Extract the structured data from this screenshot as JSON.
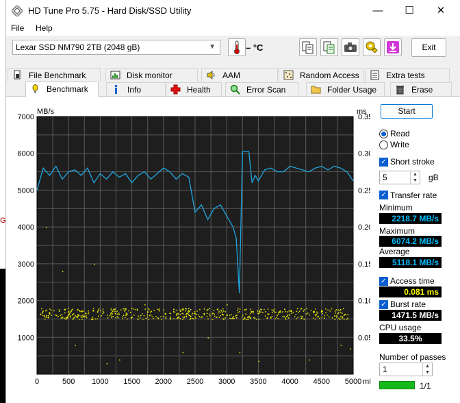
{
  "window": {
    "title": "HD Tune Pro 5.75 - Hard Disk/SSD Utility",
    "minimize": "—",
    "maximize": "☐",
    "close": "✕"
  },
  "menu": {
    "file": "File",
    "help": "Help"
  },
  "toolbar": {
    "drive": "Lexar SSD NM790 2TB (2048 gB)",
    "temperature": "– °C",
    "exit": "Exit"
  },
  "tabs_back": [
    "File Benchmark",
    "Disk monitor",
    "AAM",
    "Random Access",
    "Extra tests"
  ],
  "tabs_front": [
    "Benchmark",
    "Info",
    "Health",
    "Error Scan",
    "Folder Usage",
    "Erase"
  ],
  "side": {
    "start": "Start",
    "read": "Read",
    "write": "Write",
    "short_stroke": "Short stroke",
    "stroke_value": "5",
    "stroke_unit": "gB",
    "transfer_rate": "Transfer rate",
    "minimum_label": "Minimum",
    "minimum": "2218.7 MB/s",
    "maximum_label": "Maximum",
    "maximum": "6074.2 MB/s",
    "average_label": "Average",
    "average": "5118.1 MB/s",
    "access_time": "Access time",
    "access_value": "0.081 ms",
    "burst_rate": "Burst rate",
    "burst_value": "1471.5 MB/s",
    "cpu_label": "CPU usage",
    "cpu_value": "33.5%",
    "passes_label": "Number of passes",
    "passes_value": "1",
    "progress_text": "1/1",
    "progress_fraction": 1.0
  },
  "colors": {
    "transfer_line": "#1fa7e0",
    "access_dots": "#f0f000",
    "plot_bg": "#1e1e1e",
    "grid": "#5a5a5a"
  },
  "chart_data": {
    "type": "line",
    "left_unit": "MB/s",
    "right_unit": "ms",
    "x_unit": "mB",
    "x_ticks": [
      "0",
      "500",
      "1000",
      "1500",
      "2000",
      "2500",
      "3000",
      "3500",
      "4000",
      "4500",
      "5000"
    ],
    "y_left_ticks": [
      "7000",
      "6000",
      "5000",
      "4000",
      "3000",
      "2000",
      "1000"
    ],
    "y_right_ticks": [
      "0.35",
      "0.30",
      "0.25",
      "0.20",
      "0.15",
      "0.10",
      "0.05"
    ],
    "xlim": [
      0,
      5000
    ],
    "ylim_left": [
      0,
      7000
    ],
    "ylim_right": [
      0,
      0.35
    ],
    "series": [
      {
        "name": "Transfer rate",
        "x": [
          0,
          100,
          200,
          300,
          400,
          500,
          600,
          700,
          800,
          900,
          1000,
          1100,
          1200,
          1300,
          1400,
          1500,
          1600,
          1700,
          1800,
          1900,
          2000,
          2100,
          2200,
          2300,
          2400,
          2500,
          2600,
          2700,
          2800,
          2900,
          3000,
          3100,
          3150,
          3200,
          3250,
          3300,
          3350,
          3400,
          3450,
          3500,
          3600,
          3700,
          3800,
          3900,
          4000,
          4100,
          4200,
          4300,
          4400,
          4500,
          4600,
          4700,
          4800,
          4900,
          5000
        ],
        "y": [
          5000,
          5600,
          5400,
          5650,
          5300,
          5500,
          5550,
          5400,
          5600,
          5200,
          5450,
          5300,
          5500,
          5350,
          5450,
          5200,
          5400,
          5500,
          5300,
          5450,
          5600,
          5500,
          5300,
          5450,
          5350,
          4400,
          4600,
          4200,
          4500,
          4600,
          4300,
          4000,
          3700,
          2200,
          6050,
          6050,
          6050,
          5200,
          5400,
          5250,
          5550,
          5600,
          5500,
          5500,
          5650,
          5600,
          5550,
          5500,
          5600,
          5650,
          5550,
          5650,
          5600,
          5500,
          5250
        ]
      },
      {
        "name": "Access time",
        "points": "scatter; most samples between 0.075 and 0.09 ms, sparse outliers from 0.01 to 0.2 ms"
      }
    ]
  }
}
